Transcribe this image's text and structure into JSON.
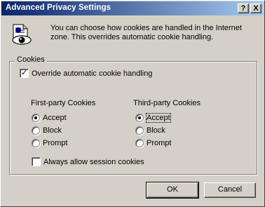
{
  "window": {
    "title": "Advanced Privacy Settings",
    "help_glyph": "?",
    "close_glyph": "X"
  },
  "intro": "You can choose how cookies are handled in the Internet zone.  This overrides automatic cookie handling.",
  "cookies_group": {
    "label": "Cookies",
    "override": {
      "label": "Override automatic cookie handling",
      "checked": true
    },
    "first_party": {
      "title": "First-party Cookies",
      "options": [
        "Accept",
        "Block",
        "Prompt"
      ],
      "selected": "Accept"
    },
    "third_party": {
      "title": "Third-party Cookies",
      "options": [
        "Accept",
        "Block",
        "Prompt"
      ],
      "selected": "Accept"
    },
    "session": {
      "label": "Always allow session cookies",
      "checked": false
    }
  },
  "buttons": {
    "ok": "OK",
    "cancel": "Cancel"
  },
  "icons": {
    "privacy": "privacy-document-eye-icon"
  }
}
